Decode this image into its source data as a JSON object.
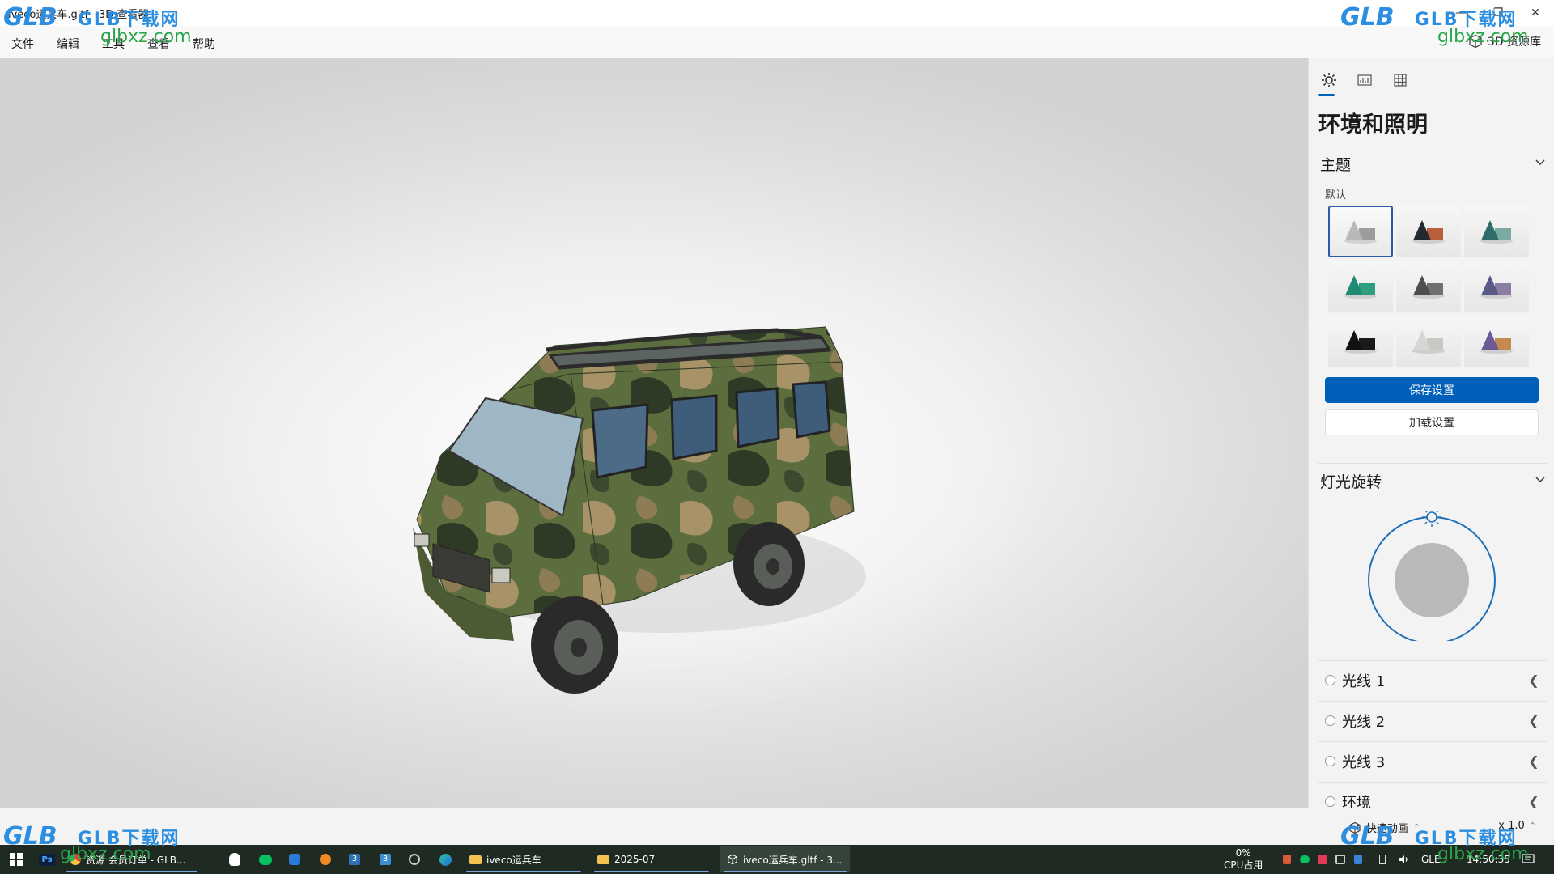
{
  "window": {
    "title": "iveco运兵车.gltf - 3D 查看器",
    "minimize": "—",
    "maximize": "❐",
    "close": "✕"
  },
  "menu": {
    "items": [
      "文件",
      "编辑",
      "工具",
      "查看",
      "帮助"
    ],
    "library_button": "3D 资源库"
  },
  "panel": {
    "title": "环境和照明",
    "theme_section": {
      "header": "主题",
      "sublabel": "默认",
      "tiles": [
        {
          "cone": "#b9b9b9",
          "box": "#9c9c9c"
        },
        {
          "cone": "#24292f",
          "box": "#b9603a"
        },
        {
          "cone": "#2f6b6a",
          "box": "#7aaaa0"
        },
        {
          "cone": "#1f8b74",
          "box": "#2e9e7e"
        },
        {
          "cone": "#4e4e4e",
          "box": "#707070"
        },
        {
          "cone": "#5a5a8a",
          "box": "#8b7ea3"
        },
        {
          "cone": "#111111",
          "box": "#1a1a1a"
        },
        {
          "cone": "#d6d6d2",
          "box": "#c9c9c4"
        },
        {
          "cone": "#6a5a96",
          "box": "#c58a52"
        }
      ],
      "selected_index": 0
    },
    "save_button": "保存设置",
    "load_button": "加载设置",
    "light_rotation_header": "灯光旋转",
    "lights": [
      "光线 1",
      "光线 2",
      "光线 3",
      "环境"
    ]
  },
  "status": {
    "quick_animation": "快速动画",
    "speed": "x 1.0"
  },
  "taskbar": {
    "apps": [
      "资源 会员订单 - GLB...",
      "iveco运兵车",
      "2025-07",
      "iveco运兵车.gltf - 3..."
    ],
    "cpu_percent": "0%",
    "cpu_label": "CPU占用",
    "ime": "GLE",
    "time": "14:50:35"
  },
  "watermark": {
    "logo": "GLB",
    "name": "GLB下载网",
    "url": "glbxz.com"
  },
  "colors": {
    "accent": "#005fb8",
    "taskbar": "#1f2b22",
    "watermark_blue": "#2c8ee0",
    "watermark_green": "#2aa64a"
  }
}
